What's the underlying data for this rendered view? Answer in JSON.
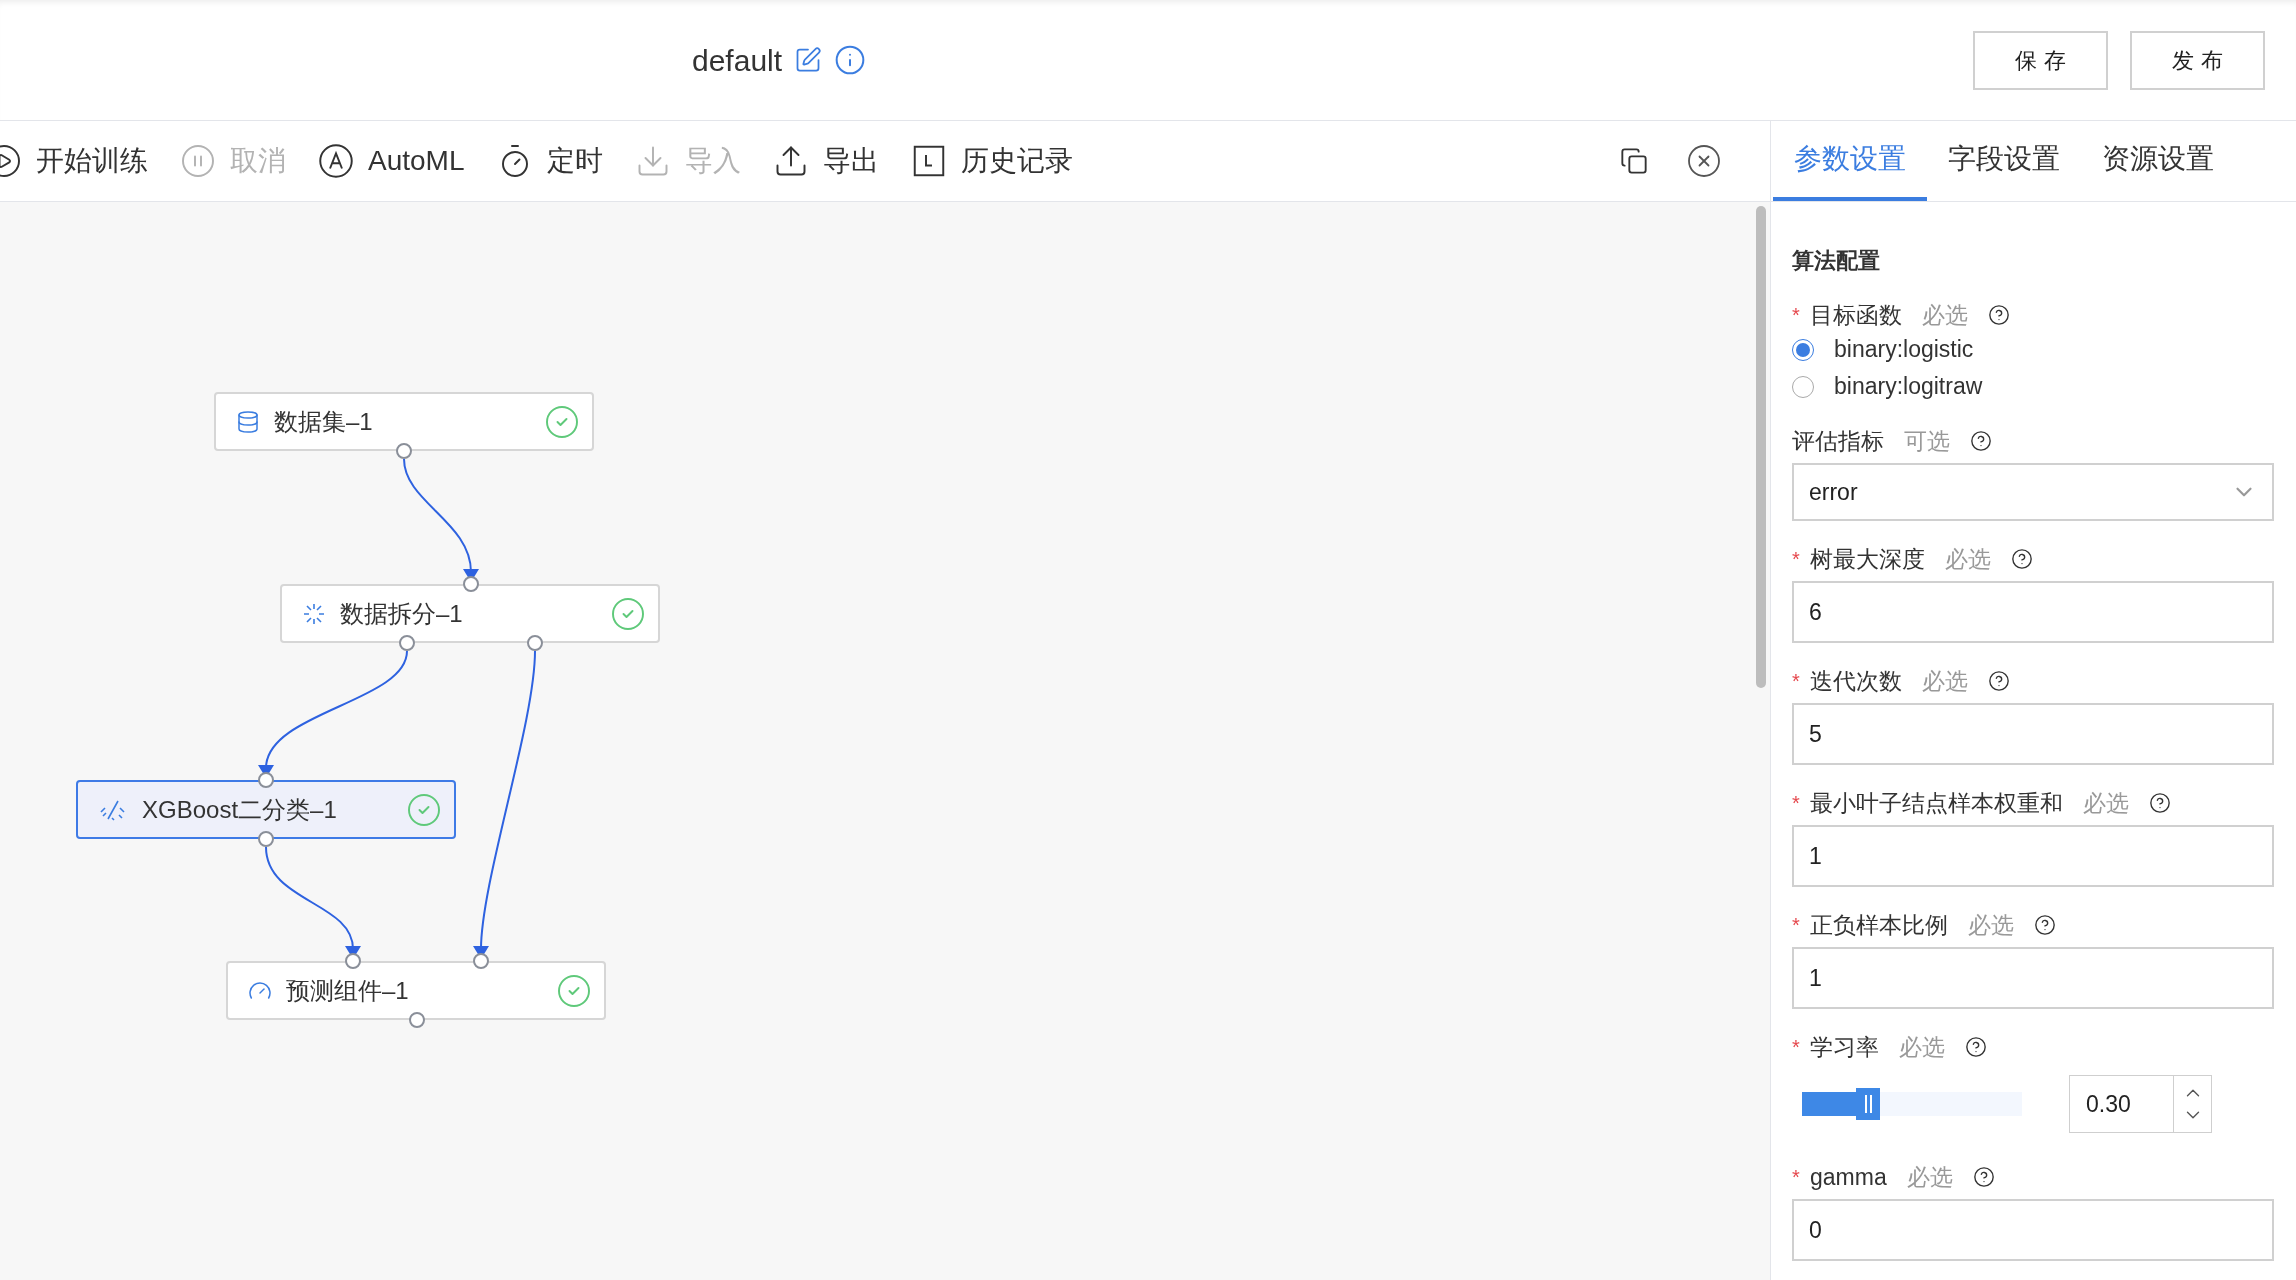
{
  "header": {
    "title": "default",
    "buttons": [
      "保 存",
      "发 布"
    ]
  },
  "toolbar": [
    {
      "kind": "start",
      "label": "开始训练",
      "disabled": false
    },
    {
      "kind": "cancel",
      "label": "取消",
      "disabled": true
    },
    {
      "kind": "automl",
      "label": "AutoML",
      "disabled": false
    },
    {
      "kind": "timer",
      "label": "定时",
      "disabled": false
    },
    {
      "kind": "import",
      "label": "导入",
      "disabled": true
    },
    {
      "kind": "export",
      "label": "导出",
      "disabled": false
    },
    {
      "kind": "history",
      "label": "历史记录",
      "disabled": false
    }
  ],
  "canvas": {
    "nodes": [
      {
        "kind": "dataset",
        "label": "数据集–1",
        "selected": false
      },
      {
        "kind": "split",
        "label": "数据拆分–1",
        "selected": false
      },
      {
        "kind": "model",
        "label": "XGBoost二分类–1",
        "selected": true
      },
      {
        "kind": "predict",
        "label": "预测组件–1",
        "selected": false
      }
    ]
  },
  "tabs": [
    {
      "label": "参数设置",
      "selected": true
    },
    {
      "label": "字段设置",
      "selected": false
    },
    {
      "label": "资源设置",
      "selected": false
    }
  ],
  "panel": {
    "section": "算法配置",
    "fields": [
      {
        "kind": "radio",
        "label": "目标函数",
        "mark": "*",
        "hint": "必选",
        "options": [
          {
            "label": "binary:logistic",
            "selected": true
          },
          {
            "label": "binary:logitraw",
            "selected": false
          }
        ]
      },
      {
        "kind": "select",
        "label": "评估指标",
        "hint": "可选",
        "value": "error"
      },
      {
        "kind": "input",
        "label": "树最大深度",
        "mark": "*",
        "hint": "必选",
        "value": "6"
      },
      {
        "kind": "input",
        "label": "迭代次数",
        "mark": "*",
        "hint": "必选",
        "value": "5"
      },
      {
        "kind": "input",
        "label": "最小叶子结点样本权重和",
        "mark": "*",
        "hint": "必选",
        "value": "1"
      },
      {
        "kind": "input",
        "label": "正负样本比例",
        "mark": "*",
        "hint": "必选",
        "value": "1"
      },
      {
        "kind": "slider",
        "label": "学习率",
        "mark": "*",
        "hint": "必选",
        "level": 0.3,
        "value": "0.30"
      },
      {
        "kind": "input",
        "label": "gamma",
        "mark": "*",
        "hint": "必选",
        "value": "0"
      }
    ]
  }
}
